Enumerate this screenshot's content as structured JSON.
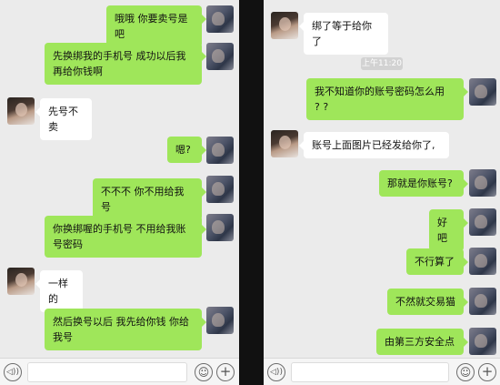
{
  "left_chat": {
    "messages": [
      {
        "from": "me",
        "text": "哦哦 你要卖号是吧"
      },
      {
        "from": "me",
        "lines": [
          "先换绑我的手机号 成功以后我",
          "再给你钱啊"
        ]
      },
      {
        "from": "them",
        "text": "先号不卖"
      },
      {
        "from": "me",
        "text": "嗯?"
      },
      {
        "from": "me",
        "text": "不不不 你不用给我号"
      },
      {
        "from": "me",
        "lines": [
          "你换绑喔的手机号 不用给我账",
          "号密码"
        ]
      },
      {
        "from": "them",
        "text": "一样的"
      },
      {
        "from": "me",
        "lines": [
          "然后换号以后 我先给你钱 你给",
          "我号"
        ]
      }
    ],
    "input": {
      "value": "",
      "placeholder": ""
    }
  },
  "right_chat": {
    "messages": [
      {
        "from": "them",
        "text": "绑了等于给你了"
      },
      {
        "from": "me",
        "lines": [
          "我不知道你的账号密码怎么用",
          "? ?"
        ]
      },
      {
        "from": "them",
        "text": "账号上面图片已经发给你了,"
      },
      {
        "from": "me",
        "text": "那就是你账号?"
      },
      {
        "from": "me",
        "text": "好吧"
      },
      {
        "from": "me",
        "text": "不行算了"
      },
      {
        "from": "me",
        "text": "不然就交易猫"
      },
      {
        "from": "me",
        "text": "由第三方安全点"
      }
    ],
    "timestamp": "上午11:20",
    "input": {
      "value": "",
      "placeholder": ""
    }
  },
  "icons": {
    "voice": "voice-icon",
    "emoji": "emoji-icon",
    "plus": "plus-icon",
    "voice_glyph": "◁))",
    "emoji_glyph": "☺",
    "plus_glyph": "+"
  },
  "colors": {
    "my_bubble": "#9fe65a",
    "their_bubble": "#ffffff",
    "background": "#ebebeb"
  }
}
